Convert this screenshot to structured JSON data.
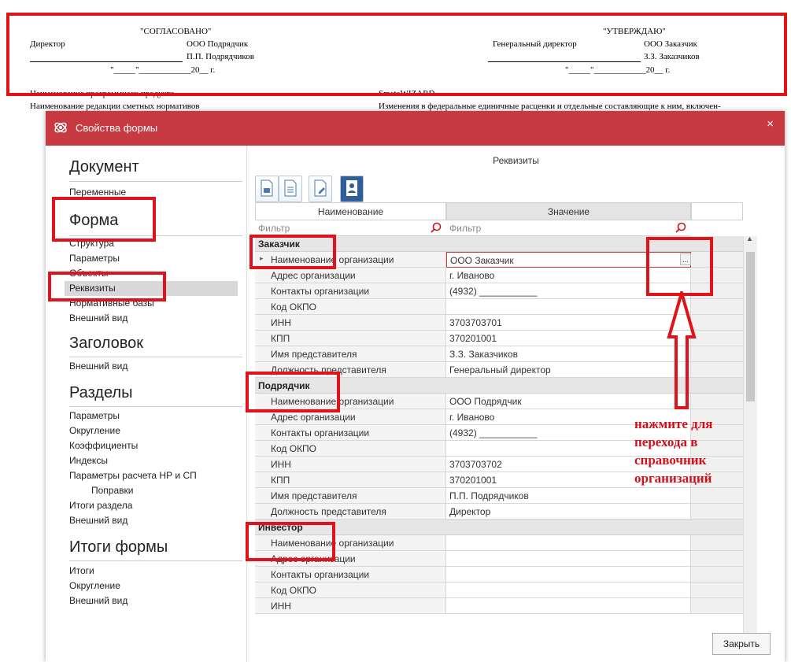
{
  "document": {
    "agreed": "\"СОГЛАСОВАНО\"",
    "approve": "\"УТВЕРЖДАЮ\"",
    "left_role": "Директор",
    "left_org": "ООО Подрядчик",
    "left_name": "П.П. Подрядчиков",
    "left_date": "\"_____\"____________20__ г.",
    "right_role": "Генеральный директор",
    "right_org": "ООО Заказчик",
    "right_name": "З.З. Заказчиков",
    "right_date": "\"_____\"____________20__ г.",
    "line1_label": "Наименование программного продукта",
    "line1_value": "SmetaWIZARD",
    "line2_label": "Наименование редакции сметных нормативов",
    "line2_value": "Изменения в федеральные единичные расценки и отдельные составляющие к ним, включен-"
  },
  "dialog": {
    "title": "Свойства формы",
    "close_glyph": "×",
    "close_button": "Закрыть"
  },
  "nav": {
    "h_document": "Документ",
    "document_items": [
      "Переменные"
    ],
    "h_form": "Форма",
    "form_items": [
      "Структура",
      "Параметры",
      "Объекты",
      "Реквизиты",
      "Нормативные базы",
      "Внешний вид"
    ],
    "h_header": "Заголовок",
    "header_items": [
      "Внешний вид"
    ],
    "h_sections": "Разделы",
    "sections_items": [
      "Параметры",
      "Округление",
      "Коэффициенты",
      "Индексы",
      "Параметры расчета НР и СП",
      "Поправки",
      "Итоги раздела",
      "Внешний вид"
    ],
    "h_totals": "Итоги формы",
    "totals_items": [
      "Итоги",
      "Округление",
      "Внешний вид"
    ]
  },
  "panel": {
    "title": "Реквизиты",
    "col_name": "Наименование",
    "col_value": "Значение",
    "filter_placeholder": "Фильтр",
    "ellipsis": "..."
  },
  "groups": [
    {
      "name": "Заказчик",
      "rows": [
        [
          "Наименование организации",
          "ООО Заказчик"
        ],
        [
          "Адрес организации",
          "г. Иваново"
        ],
        [
          "Контакты организации",
          "(4932) ___________"
        ],
        [
          "Код ОКПО",
          ""
        ],
        [
          "ИНН",
          "3703703701"
        ],
        [
          "КПП",
          "370201001"
        ],
        [
          "Имя представителя",
          "З.З. Заказчиков"
        ],
        [
          "Должность представителя",
          "Генеральный директор"
        ]
      ]
    },
    {
      "name": "Подрядчик",
      "rows": [
        [
          "Наименование организации",
          "ООО Подрядчик"
        ],
        [
          "Адрес организации",
          "г. Иваново"
        ],
        [
          "Контакты организации",
          "(4932) ___________"
        ],
        [
          "Код ОКПО",
          ""
        ],
        [
          "ИНН",
          "3703703702"
        ],
        [
          "КПП",
          "370201001"
        ],
        [
          "Имя представителя",
          "П.П. Подрядчиков"
        ],
        [
          "Должность представителя",
          "Директор"
        ]
      ]
    },
    {
      "name": "Инвестор",
      "rows": [
        [
          "Наименование организации",
          ""
        ],
        [
          "Адрес организации",
          ""
        ],
        [
          "Контакты организации",
          ""
        ],
        [
          "Код ОКПО",
          ""
        ],
        [
          "ИНН",
          ""
        ]
      ]
    }
  ],
  "annotation": "нажмите для перехода в справочник организаций",
  "colors": {
    "accent": "#c83a41",
    "highlight": "#e0121a"
  }
}
